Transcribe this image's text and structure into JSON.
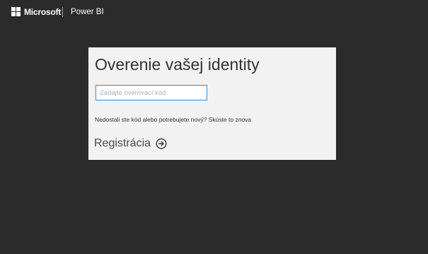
{
  "header": {
    "brand": "Microsoft",
    "product": "Power BI",
    "logo_icon": "microsoft-logo-icon"
  },
  "card": {
    "title": "Overenie vašej identity",
    "code_input": {
      "value": "",
      "placeholder": "Zadajte overovací kód"
    },
    "resend_text": "Nedostali ste kód alebo potrebujete nový?",
    "resend_link": "Skúste to znova",
    "register_label": "Registrácia",
    "register_icon": "arrow-right-circle-icon"
  },
  "colors": {
    "background": "#2b2b2b",
    "card": "#f2f2f2",
    "input_border": "#2b8ad8",
    "text": "#333333"
  }
}
